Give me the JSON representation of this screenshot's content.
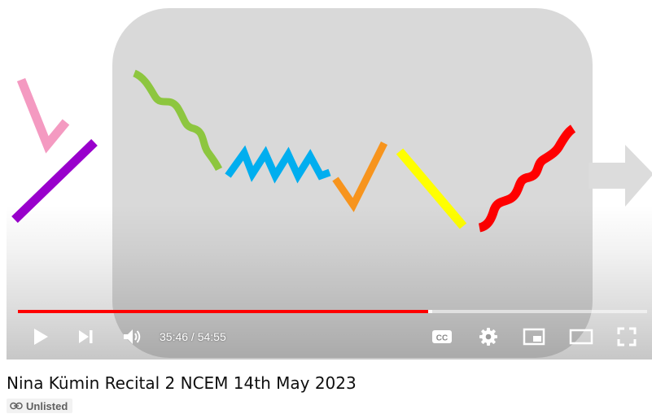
{
  "video": {
    "title": "Nina Kümin Recital 2 NCEM 14th May 2023",
    "badge": "Unlisted",
    "badge_icon": "link-icon",
    "progress_fraction": 0.6515,
    "loaded_fraction": 0.658
  },
  "player": {
    "current_time": "35:46",
    "separator": " / ",
    "duration": "54:55",
    "progress_color": "#ff0000",
    "icons": [
      "play-icon",
      "next-icon",
      "volume-icon",
      "captions-icon",
      "settings-icon",
      "miniplayer-icon",
      "theater-mode-icon",
      "fullscreen-icon"
    ]
  },
  "artwork": {
    "colors": {
      "background": "#d9d9d9",
      "pink": "#f49ac1",
      "purple": "#9900cc",
      "green": "#8dc63f",
      "blue": "#00aeef",
      "orange": "#f7941d",
      "yellow": "#ffff00",
      "red": "#ff0000",
      "arrow": "#dcdcdc"
    }
  }
}
